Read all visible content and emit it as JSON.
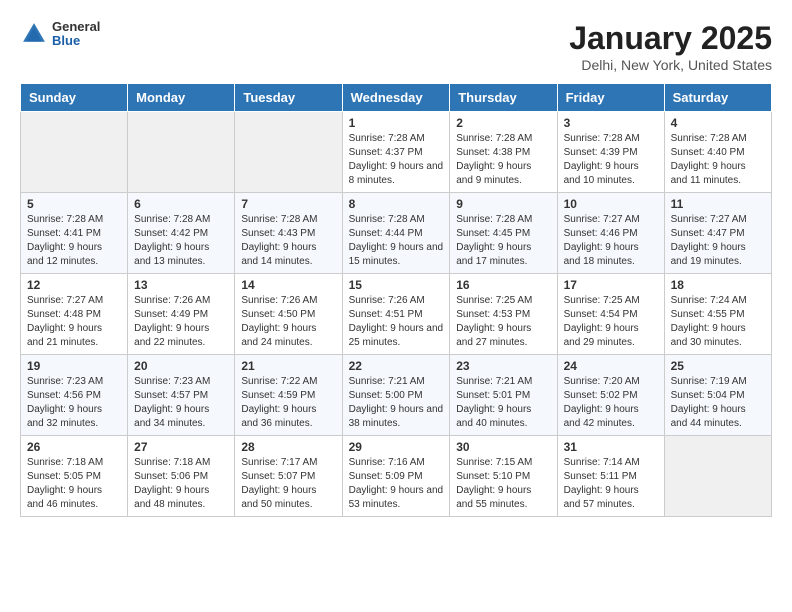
{
  "logo": {
    "general": "General",
    "blue": "Blue"
  },
  "title": "January 2025",
  "location": "Delhi, New York, United States",
  "weekdays": [
    "Sunday",
    "Monday",
    "Tuesday",
    "Wednesday",
    "Thursday",
    "Friday",
    "Saturday"
  ],
  "weeks": [
    [
      {
        "day": "",
        "info": ""
      },
      {
        "day": "",
        "info": ""
      },
      {
        "day": "",
        "info": ""
      },
      {
        "day": "1",
        "info": "Sunrise: 7:28 AM\nSunset: 4:37 PM\nDaylight: 9 hours and 8 minutes."
      },
      {
        "day": "2",
        "info": "Sunrise: 7:28 AM\nSunset: 4:38 PM\nDaylight: 9 hours and 9 minutes."
      },
      {
        "day": "3",
        "info": "Sunrise: 7:28 AM\nSunset: 4:39 PM\nDaylight: 9 hours and 10 minutes."
      },
      {
        "day": "4",
        "info": "Sunrise: 7:28 AM\nSunset: 4:40 PM\nDaylight: 9 hours and 11 minutes."
      }
    ],
    [
      {
        "day": "5",
        "info": "Sunrise: 7:28 AM\nSunset: 4:41 PM\nDaylight: 9 hours and 12 minutes."
      },
      {
        "day": "6",
        "info": "Sunrise: 7:28 AM\nSunset: 4:42 PM\nDaylight: 9 hours and 13 minutes."
      },
      {
        "day": "7",
        "info": "Sunrise: 7:28 AM\nSunset: 4:43 PM\nDaylight: 9 hours and 14 minutes."
      },
      {
        "day": "8",
        "info": "Sunrise: 7:28 AM\nSunset: 4:44 PM\nDaylight: 9 hours and 15 minutes."
      },
      {
        "day": "9",
        "info": "Sunrise: 7:28 AM\nSunset: 4:45 PM\nDaylight: 9 hours and 17 minutes."
      },
      {
        "day": "10",
        "info": "Sunrise: 7:27 AM\nSunset: 4:46 PM\nDaylight: 9 hours and 18 minutes."
      },
      {
        "day": "11",
        "info": "Sunrise: 7:27 AM\nSunset: 4:47 PM\nDaylight: 9 hours and 19 minutes."
      }
    ],
    [
      {
        "day": "12",
        "info": "Sunrise: 7:27 AM\nSunset: 4:48 PM\nDaylight: 9 hours and 21 minutes."
      },
      {
        "day": "13",
        "info": "Sunrise: 7:26 AM\nSunset: 4:49 PM\nDaylight: 9 hours and 22 minutes."
      },
      {
        "day": "14",
        "info": "Sunrise: 7:26 AM\nSunset: 4:50 PM\nDaylight: 9 hours and 24 minutes."
      },
      {
        "day": "15",
        "info": "Sunrise: 7:26 AM\nSunset: 4:51 PM\nDaylight: 9 hours and 25 minutes."
      },
      {
        "day": "16",
        "info": "Sunrise: 7:25 AM\nSunset: 4:53 PM\nDaylight: 9 hours and 27 minutes."
      },
      {
        "day": "17",
        "info": "Sunrise: 7:25 AM\nSunset: 4:54 PM\nDaylight: 9 hours and 29 minutes."
      },
      {
        "day": "18",
        "info": "Sunrise: 7:24 AM\nSunset: 4:55 PM\nDaylight: 9 hours and 30 minutes."
      }
    ],
    [
      {
        "day": "19",
        "info": "Sunrise: 7:23 AM\nSunset: 4:56 PM\nDaylight: 9 hours and 32 minutes."
      },
      {
        "day": "20",
        "info": "Sunrise: 7:23 AM\nSunset: 4:57 PM\nDaylight: 9 hours and 34 minutes."
      },
      {
        "day": "21",
        "info": "Sunrise: 7:22 AM\nSunset: 4:59 PM\nDaylight: 9 hours and 36 minutes."
      },
      {
        "day": "22",
        "info": "Sunrise: 7:21 AM\nSunset: 5:00 PM\nDaylight: 9 hours and 38 minutes."
      },
      {
        "day": "23",
        "info": "Sunrise: 7:21 AM\nSunset: 5:01 PM\nDaylight: 9 hours and 40 minutes."
      },
      {
        "day": "24",
        "info": "Sunrise: 7:20 AM\nSunset: 5:02 PM\nDaylight: 9 hours and 42 minutes."
      },
      {
        "day": "25",
        "info": "Sunrise: 7:19 AM\nSunset: 5:04 PM\nDaylight: 9 hours and 44 minutes."
      }
    ],
    [
      {
        "day": "26",
        "info": "Sunrise: 7:18 AM\nSunset: 5:05 PM\nDaylight: 9 hours and 46 minutes."
      },
      {
        "day": "27",
        "info": "Sunrise: 7:18 AM\nSunset: 5:06 PM\nDaylight: 9 hours and 48 minutes."
      },
      {
        "day": "28",
        "info": "Sunrise: 7:17 AM\nSunset: 5:07 PM\nDaylight: 9 hours and 50 minutes."
      },
      {
        "day": "29",
        "info": "Sunrise: 7:16 AM\nSunset: 5:09 PM\nDaylight: 9 hours and 53 minutes."
      },
      {
        "day": "30",
        "info": "Sunrise: 7:15 AM\nSunset: 5:10 PM\nDaylight: 9 hours and 55 minutes."
      },
      {
        "day": "31",
        "info": "Sunrise: 7:14 AM\nSunset: 5:11 PM\nDaylight: 9 hours and 57 minutes."
      },
      {
        "day": "",
        "info": ""
      }
    ]
  ]
}
